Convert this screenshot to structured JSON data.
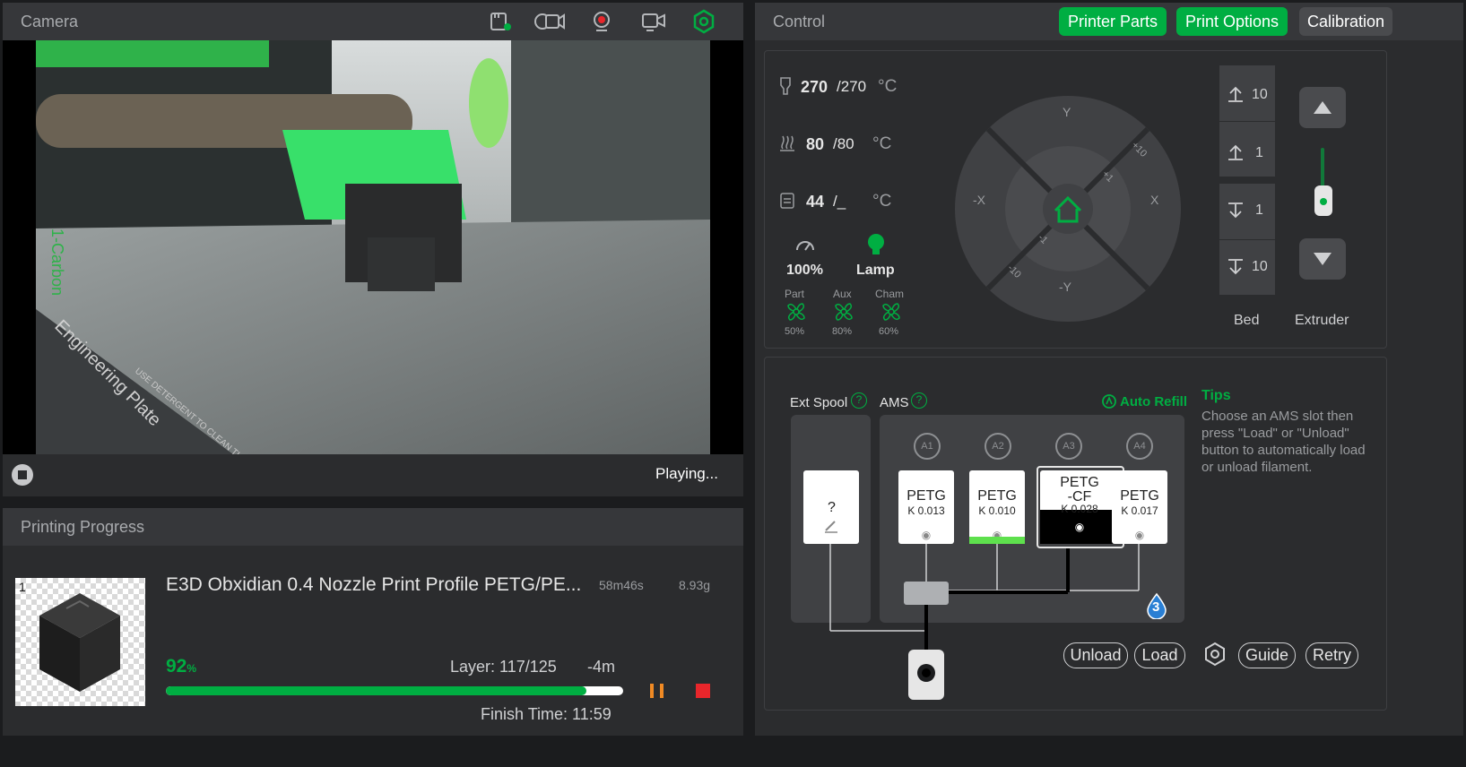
{
  "camera": {
    "title": "Camera",
    "status": "Playing...",
    "scene_text": [
      "1-Carbon",
      "Engineering Plate",
      "USE DETERGENT TO CLEAN THE SU"
    ]
  },
  "progress": {
    "title": "Printing Progress",
    "plate_number": "1",
    "job_name": "E3D Obxidian 0.4 Nozzle Print Profile PETG/PE...",
    "time": "58m46s",
    "weight": "8.93g",
    "percent_value": "92",
    "percent_unit": "%",
    "percent_fraction": 0.92,
    "layer": "Layer: 117/125",
    "remaining": "-4m",
    "finish_time": "Finish Time: 11:59"
  },
  "control": {
    "title": "Control",
    "tabs": [
      "Printer Parts",
      "Print Options",
      "Calibration"
    ],
    "nozzle": {
      "current": "270",
      "target": "/270",
      "unit": "°C"
    },
    "bed": {
      "current": "80",
      "target": "/80",
      "unit": "°C"
    },
    "chamber": {
      "current": "44",
      "target": "/_",
      "unit": "°C"
    },
    "speed": "100%",
    "lamp": "Lamp",
    "fans": [
      {
        "label": "Part",
        "value": "50%"
      },
      {
        "label": "Aux",
        "value": "80%"
      },
      {
        "label": "Cham",
        "value": "60%"
      }
    ],
    "jog": {
      "y_plus": "Y",
      "y_minus": "-Y",
      "x_plus": "X",
      "x_minus": "-X",
      "plus10": "+10",
      "plus1": "+1",
      "minus1": "-1",
      "minus10": "-10"
    },
    "bed_moves": [
      "10",
      "1",
      "1",
      "10"
    ],
    "bed_label": "Bed",
    "extruder_label": "Extruder"
  },
  "ams": {
    "ext_spool_label": "Ext Spool",
    "ams_label": "AMS",
    "help": "?",
    "auto_refill": "Auto Refill",
    "tips_title": "Tips",
    "tips_text": "Choose an AMS slot then press \"Load\" or \"Unload\" button to automatically load or unload filament.",
    "ext_slot_text": "?",
    "slots": [
      {
        "id": "A1",
        "type": "PETG",
        "k": "K 0.013",
        "color": "#ffffff"
      },
      {
        "id": "A2",
        "type": "PETG",
        "k": "K 0.010",
        "color": "#5ee04d"
      },
      {
        "id": "A3",
        "type": "PETG\n-CF",
        "k": "K 0.028",
        "color": "#000000"
      },
      {
        "id": "A4",
        "type": "PETG",
        "k": "K 0.017",
        "color": "#ffffff"
      }
    ],
    "humidity": "3",
    "buttons": {
      "unload": "Unload",
      "load": "Load",
      "guide": "Guide",
      "retry": "Retry"
    }
  },
  "colors": {
    "accent": "#00ae42",
    "panel": "#2b2c2e",
    "header": "#36373a",
    "stop": "#e8262b",
    "pause": "#f08a24"
  }
}
